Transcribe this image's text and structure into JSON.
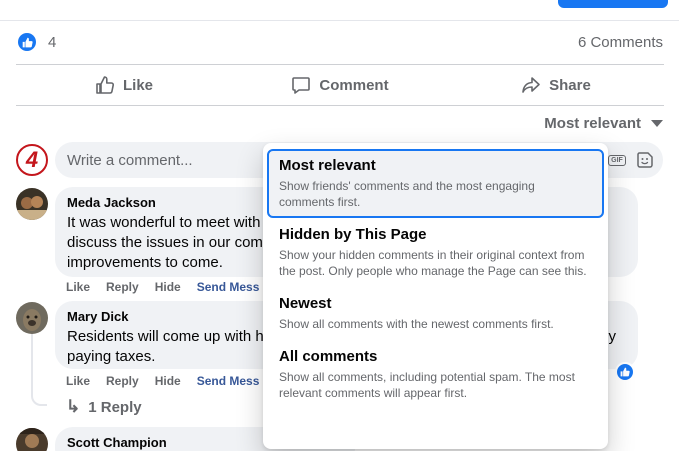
{
  "post": {
    "reaction_count": "4",
    "comment_count": "6 Comments"
  },
  "actions": {
    "like": "Like",
    "comment": "Comment",
    "share": "Share"
  },
  "sort": {
    "selected": "Most relevant"
  },
  "composer": {
    "avatar_text": "4",
    "placeholder": "Write a comment..."
  },
  "comments": [
    {
      "author": "Meda Jackson",
      "text": "It was wonderful to meet with",
      "text2": "discuss the issues in our com",
      "text3": "improvements to come.",
      "like": "Like",
      "reply": "Reply",
      "hide": "Hide",
      "send": "Send Mess"
    },
    {
      "author": "Mary Dick",
      "text": "Residents will come up with h",
      "text_tail": "y",
      "text2": "paying taxes.",
      "like": "Like",
      "reply": "Reply",
      "hide": "Hide",
      "send": "Send Mess",
      "replies_label": "1 Reply"
    },
    {
      "author": "Scott Champion"
    }
  ],
  "sort_menu": {
    "items": [
      {
        "title": "Most relevant",
        "desc": "Show friends' comments and the most engaging comments first."
      },
      {
        "title": "Hidden by This Page",
        "desc": "Show your hidden comments in their original context from the post. Only people who manage the Page can see this."
      },
      {
        "title": "Newest",
        "desc": "Show all comments with the newest comments first."
      },
      {
        "title": "All comments",
        "desc": "Show all comments, including potential spam. The most relevant comments will appear first."
      }
    ]
  },
  "colors": {
    "accent": "#1877f2",
    "muted_text": "#65676b",
    "bubble": "#f0f2f5",
    "station_red": "#c4161c"
  }
}
